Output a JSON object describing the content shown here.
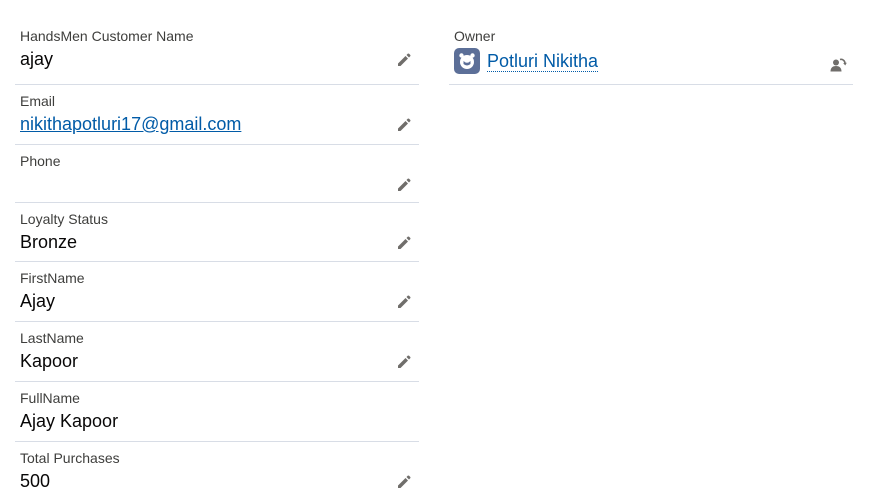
{
  "fields": [
    {
      "label": "HandsMen Customer Name",
      "value": "ajay",
      "editable": true,
      "link": false
    },
    {
      "label": "Email",
      "value": "nikithapotluri17@gmail.com",
      "editable": true,
      "link": true
    },
    {
      "label": "Phone",
      "value": "",
      "editable": true,
      "link": false
    },
    {
      "label": "Loyalty Status",
      "value": "Bronze",
      "editable": true,
      "link": false
    },
    {
      "label": "FirstName",
      "value": "Ajay",
      "editable": true,
      "link": false
    },
    {
      "label": "LastName",
      "value": "Kapoor",
      "editable": true,
      "link": false
    },
    {
      "label": "FullName",
      "value": "Ajay Kapoor",
      "editable": false,
      "link": false
    },
    {
      "label": "Total Purchases",
      "value": "500",
      "editable": true,
      "link": false
    }
  ],
  "owner": {
    "label": "Owner",
    "name": "Potluri Nikitha",
    "avatar_icon": "user-avatar-icon",
    "action_icon": "change-owner-icon"
  },
  "icons": {
    "edit": "pencil-icon"
  },
  "colors": {
    "link": "#015ba7",
    "label": "#3e3e3c",
    "divider": "#d8dde6",
    "icon": "#706e6b",
    "avatar_bg": "#5c6f98"
  }
}
